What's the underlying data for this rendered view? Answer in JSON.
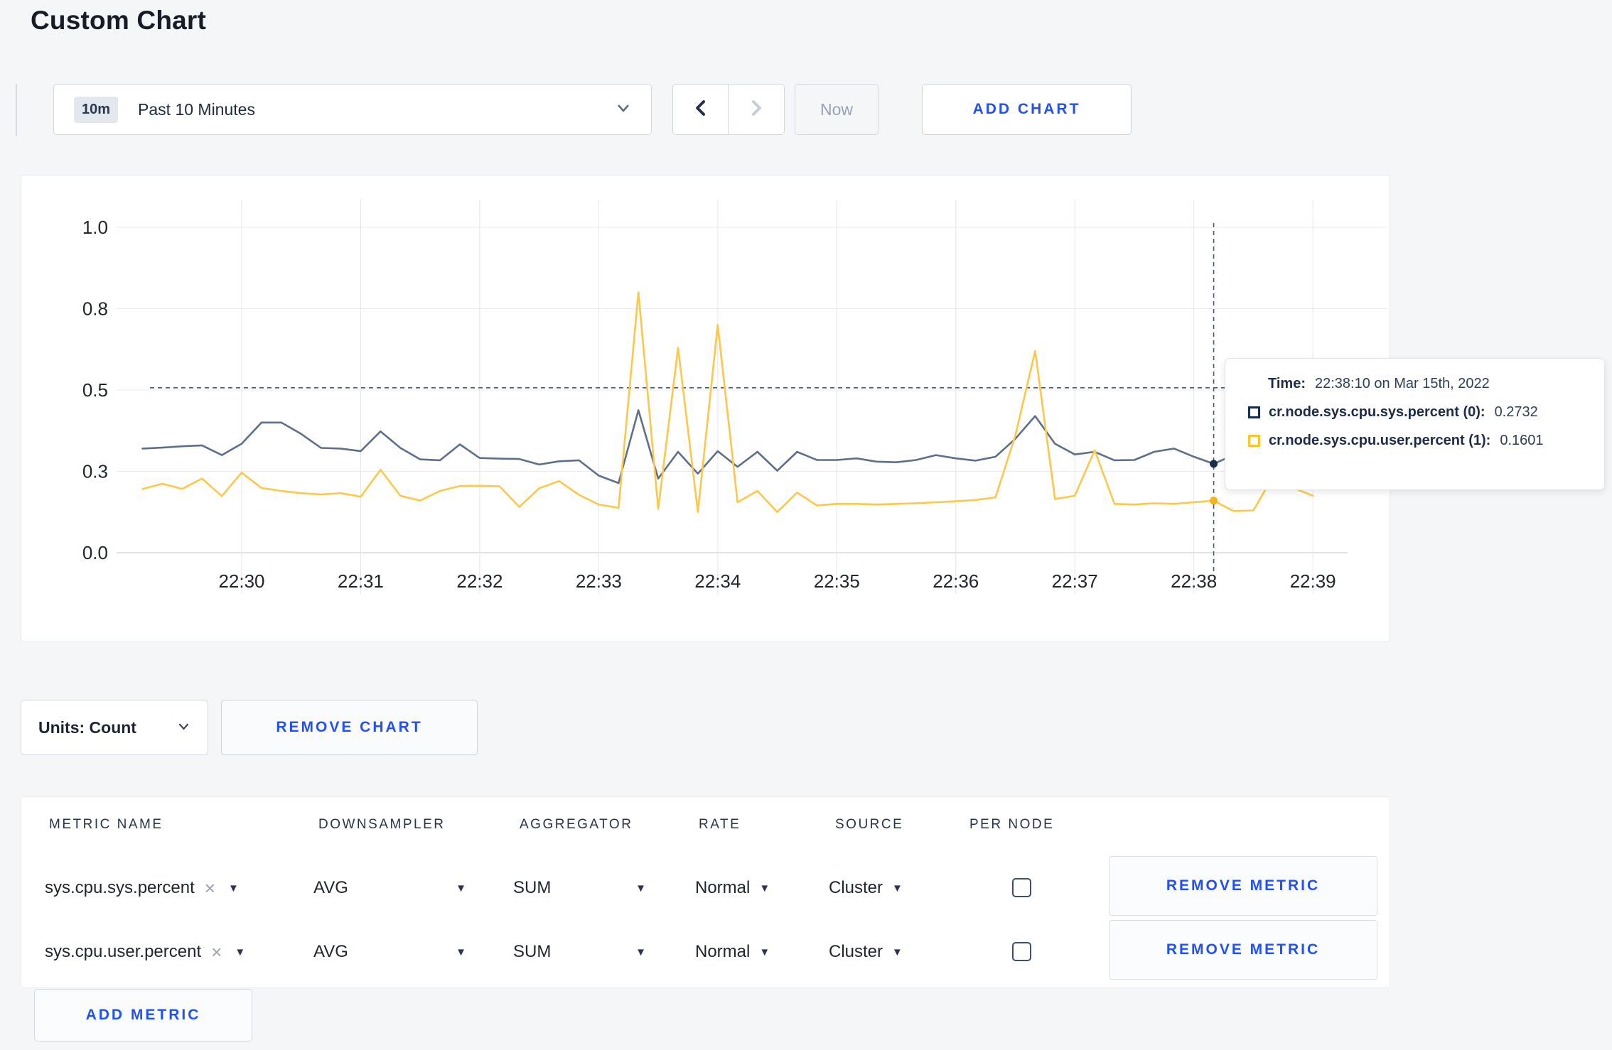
{
  "page": {
    "title": "Custom Chart"
  },
  "toolbar": {
    "time_badge": "10m",
    "time_range_label": "Past 10 Minutes",
    "now_label": "Now",
    "add_chart_label": "ADD CHART"
  },
  "chart": {
    "units_label": "Units: Count",
    "remove_chart_label": "REMOVE CHART",
    "tooltip": {
      "time_label": "Time:",
      "time_value": "22:38:10 on Mar 15th, 2022",
      "series": [
        {
          "name": "cr.node.sys.cpu.sys.percent (0):",
          "value": "0.2732",
          "swatch_color": "#1b2b4e"
        },
        {
          "name": "cr.node.sys.cpu.user.percent (1):",
          "value": "0.1601",
          "swatch_color": "#ffc62b"
        }
      ]
    }
  },
  "chart_data": {
    "type": "line",
    "title": "",
    "xlabel": "",
    "ylabel": "",
    "ylim": [
      0,
      1
    ],
    "grid": true,
    "x_tick_labels": [
      "22:30",
      "22:31",
      "22:32",
      "22:33",
      "22:34",
      "22:35",
      "22:36",
      "22:37",
      "22:38",
      "22:39"
    ],
    "y_tick_labels": [
      "0.0",
      "0.3",
      "0.5",
      "0.8",
      "1.0"
    ],
    "y_tick_values": [
      0,
      0.25,
      0.5,
      0.75,
      1.0
    ],
    "x_start_time": "22:29:10",
    "x_interval_seconds": 10,
    "series": [
      {
        "name": "cr.node.sys.cpu.sys.percent",
        "color": "#5e6e8c",
        "values": [
          0.32,
          0.323,
          0.327,
          0.33,
          0.3,
          0.335,
          0.4,
          0.4,
          0.365,
          0.322,
          0.32,
          0.312,
          0.373,
          0.322,
          0.287,
          0.284,
          0.333,
          0.291,
          0.289,
          0.288,
          0.271,
          0.281,
          0.284,
          0.237,
          0.214,
          0.438,
          0.228,
          0.31,
          0.243,
          0.312,
          0.264,
          0.31,
          0.252,
          0.31,
          0.285,
          0.285,
          0.29,
          0.28,
          0.278,
          0.285,
          0.3,
          0.29,
          0.283,
          0.295,
          0.35,
          0.42,
          0.335,
          0.302,
          0.31,
          0.284,
          0.285,
          0.31,
          0.32,
          0.295,
          0.2732,
          0.3,
          0.315,
          0.305,
          0.295,
          0.3
        ]
      },
      {
        "name": "cr.node.sys.cpu.user.percent",
        "color": "#fcc84a",
        "values": [
          0.196,
          0.212,
          0.196,
          0.228,
          0.174,
          0.246,
          0.199,
          0.19,
          0.183,
          0.179,
          0.183,
          0.172,
          0.255,
          0.175,
          0.16,
          0.19,
          0.205,
          0.206,
          0.204,
          0.141,
          0.198,
          0.22,
          0.178,
          0.148,
          0.138,
          0.8,
          0.135,
          0.63,
          0.125,
          0.7,
          0.155,
          0.19,
          0.125,
          0.185,
          0.145,
          0.15,
          0.15,
          0.148,
          0.15,
          0.152,
          0.155,
          0.158,
          0.162,
          0.17,
          0.36,
          0.62,
          0.165,
          0.175,
          0.315,
          0.15,
          0.148,
          0.152,
          0.15,
          0.155,
          0.1601,
          0.128,
          0.13,
          0.235,
          0.2,
          0.175
        ]
      }
    ],
    "crosshair": {
      "time": "22:38:10",
      "point_index": 54,
      "cursor_y_value": 0.507,
      "highlighted_points": [
        {
          "value": 0.2732,
          "color": "#1c2b4a"
        },
        {
          "value": 0.1601,
          "color": "#f3b51d"
        }
      ]
    },
    "legend_position": "tooltip-only"
  },
  "metrics_table": {
    "headers": [
      "METRIC NAME",
      "DOWNSAMPLER",
      "AGGREGATOR",
      "RATE",
      "SOURCE",
      "PER NODE"
    ],
    "rows": [
      {
        "metric": "sys.cpu.sys.percent",
        "downsampler": "AVG",
        "aggregator": "SUM",
        "rate": "Normal",
        "source": "Cluster",
        "per_node_checked": false,
        "remove_label": "REMOVE METRIC"
      },
      {
        "metric": "sys.cpu.user.percent",
        "downsampler": "AVG",
        "aggregator": "SUM",
        "rate": "Normal",
        "source": "Cluster",
        "per_node_checked": false,
        "remove_label": "REMOVE METRIC"
      }
    ],
    "add_metric_label": "ADD METRIC"
  }
}
